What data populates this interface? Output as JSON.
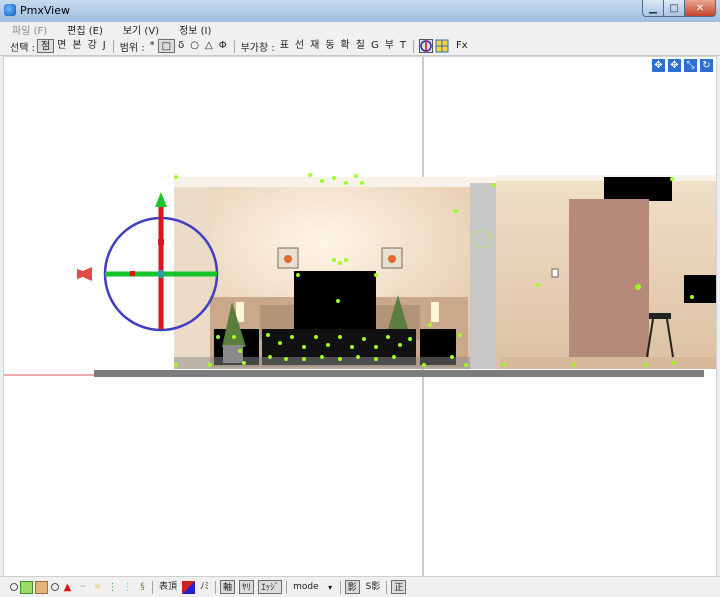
{
  "window": {
    "title": "PmxView"
  },
  "menu": [
    {
      "label": "파일 (F)",
      "enabled": false
    },
    {
      "label": "편집 (E)",
      "enabled": true
    },
    {
      "label": "보기 (V)",
      "enabled": true
    },
    {
      "label": "정보 (I)",
      "enabled": true
    }
  ],
  "toolbar": {
    "select_label": "선택 :",
    "select_items": [
      "점",
      "면",
      "본",
      "강",
      "J"
    ],
    "range_label": "범위 :",
    "range_items": [
      "*",
      "□",
      "δ",
      "○",
      "△",
      "Φ"
    ],
    "aux_label": "부가창 :",
    "aux_items": [
      "표",
      "선",
      "재",
      "동",
      "확",
      "칠",
      "G",
      "부",
      "T"
    ],
    "fx_label": "Fx"
  },
  "status": {
    "mark_label": "表頂",
    "scale_label": "ﾉﾐ",
    "axis_label": "軸",
    "ik_label": "ﾔﾘ",
    "edge_label": "ｴｯｼﾞ",
    "mode_label": "mode",
    "shadow_label": "影",
    "sshadow_label": "S影",
    "ortho_label": "正"
  },
  "colors": {
    "titlebar": "#a9c6e6",
    "close": "#c4442a",
    "gizmo_ring": "#3f3fc0",
    "gizmo_x": "#17c42a",
    "gizmo_y": "#d9161a",
    "selection": "#9cff23"
  }
}
